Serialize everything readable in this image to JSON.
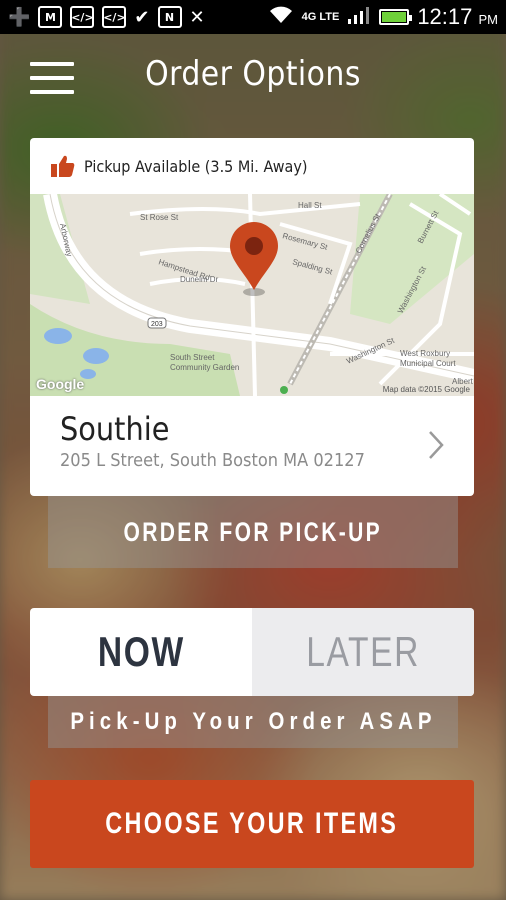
{
  "status_bar": {
    "time": "12:17",
    "ampm": "PM",
    "network": "4G LTE",
    "left_icons": [
      "add-icon",
      "gmail-icon",
      "code-icon",
      "code-icon",
      "chat-icon",
      "nfc-icon",
      "mute-icon"
    ],
    "right_icons": [
      "wifi-icon",
      "signal-icon",
      "battery-charging-icon"
    ]
  },
  "header": {
    "title": "Order Options",
    "menu_icon": "hamburger-menu-icon"
  },
  "location_card": {
    "pickup_text": "Pickup Available (3.5 Mi. Away)",
    "pickup_icon": "thumbs-up-icon",
    "map": {
      "watermark": "Google",
      "attribution": "Map data ©2015 Google",
      "labels": [
        "St Rose St",
        "Hall St",
        "Hampstead Rd",
        "Dunelm Dr",
        "Rosemary St",
        "Spalding St",
        "Washington St",
        "Burnett St",
        "Cornelius St",
        "South Street Community Garden",
        "West Roxbury Municipal Court",
        "Albert",
        "Arborway"
      ],
      "route_badge": "203",
      "pin_icon": "map-pin-icon"
    },
    "location_name": "Southie",
    "location_address": "205 L Street, South Boston MA 02127",
    "chevron_icon": "chevron-right-icon"
  },
  "order_for": {
    "label": "ORDER FOR PICK-UP"
  },
  "time_toggle": {
    "now_label": "NOW",
    "later_label": "LATER",
    "selected": "NOW"
  },
  "asap_note": "Pick-Up Your Order ASAP",
  "cta": {
    "label": "CHOOSE YOUR ITEMS",
    "color": "#c9471e"
  },
  "colors": {
    "accent": "#c9471e",
    "pin": "#c9471e",
    "battery": "#6fd13a"
  }
}
